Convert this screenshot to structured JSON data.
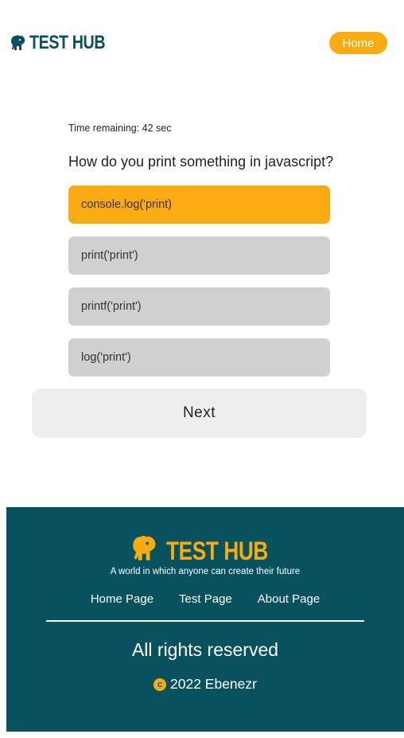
{
  "header": {
    "brand": "TEST HUB",
    "brand_icon": "elephant-icon",
    "home_label": "Home"
  },
  "quiz": {
    "timer": "Time remaining: 42 sec",
    "question": "How do you print something in javascript?",
    "options": [
      {
        "label": "console.log('print)",
        "selected": true
      },
      {
        "label": "print('print')",
        "selected": false
      },
      {
        "label": "printf('print')",
        "selected": false
      },
      {
        "label": "log('print')",
        "selected": false
      }
    ],
    "next_label": "Next"
  },
  "footer": {
    "brand": "TEST HUB",
    "brand_icon": "elephant-icon",
    "tagline": "A world in which anyone can create their future",
    "nav": [
      "Home Page",
      "Test Page",
      "About Page"
    ],
    "rights": "All rights reserved",
    "copyright_symbol": "c",
    "copyright": "2022 Ebenezr"
  },
  "colors": {
    "accent": "#fbab12",
    "brand_dark": "#0b4f63",
    "footer_bg": "#08515f",
    "option_bg": "#d0d0d0",
    "next_bg": "#eeeeee"
  }
}
